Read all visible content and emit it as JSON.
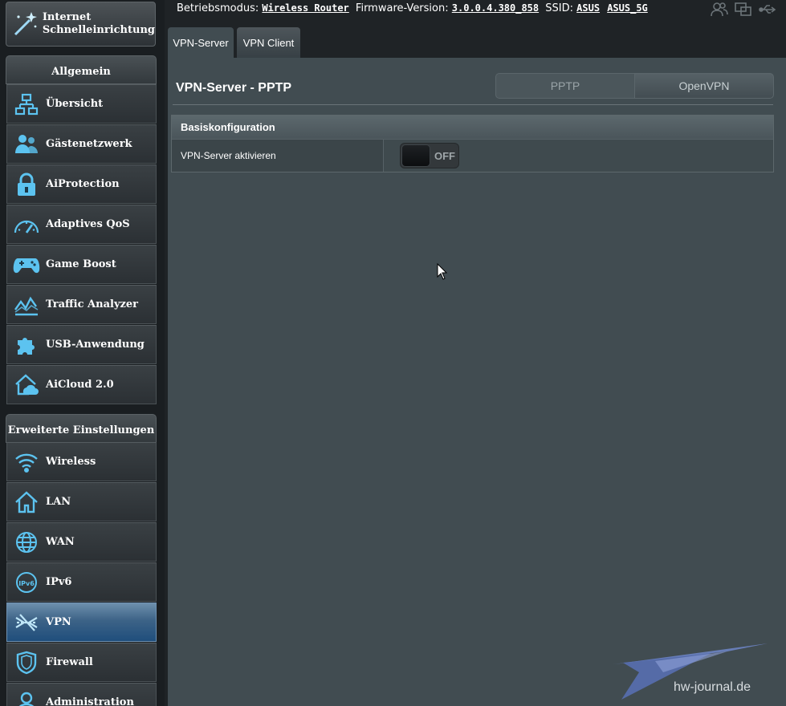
{
  "sidebar": {
    "quick_setup": "Internet\nSchnelleinrichtung",
    "general_header": "Allgemein",
    "general_items": [
      {
        "label": "Übersicht"
      },
      {
        "label": "Gästenetzwerk"
      },
      {
        "label": "AiProtection"
      },
      {
        "label": "Adaptives QoS"
      },
      {
        "label": "Game Boost"
      },
      {
        "label": "Traffic Analyzer"
      },
      {
        "label": "USB-Anwendung"
      },
      {
        "label": "AiCloud 2.0"
      }
    ],
    "advanced_header": "Erweiterte Einstellungen",
    "advanced_items": [
      {
        "label": "Wireless"
      },
      {
        "label": "LAN"
      },
      {
        "label": "WAN"
      },
      {
        "label": "IPv6"
      },
      {
        "label": "VPN"
      },
      {
        "label": "Firewall"
      },
      {
        "label": "Administration"
      }
    ],
    "active_item": "VPN"
  },
  "topbar": {
    "mode_label": "Betriebsmodus:",
    "mode_value": "Wireless Router",
    "fw_label": "Firmware-Version:",
    "fw_value": "3.0.0.4.380_858",
    "ssid_label": "SSID:",
    "ssid_1": "ASUS",
    "ssid_2": "ASUS_5G"
  },
  "tabs": [
    {
      "label": "VPN-Server",
      "active": true
    },
    {
      "label": "VPN Client",
      "active": false
    }
  ],
  "main": {
    "title": "VPN-Server - PPTP",
    "segments": [
      {
        "label": "PPTP",
        "selected": true
      },
      {
        "label": "OpenVPN",
        "selected": false
      }
    ],
    "section_header": "Basiskonfiguration",
    "rows": [
      {
        "label": "VPN-Server aktivieren",
        "toggle_state": "OFF"
      }
    ]
  },
  "watermark": {
    "text": "hw-journal.de"
  },
  "colors": {
    "accent_icon": "#5cc3f0",
    "active_item_bg": "#2f5a85",
    "panel_bg": "#414c51",
    "page_bg": "#1f2326"
  }
}
